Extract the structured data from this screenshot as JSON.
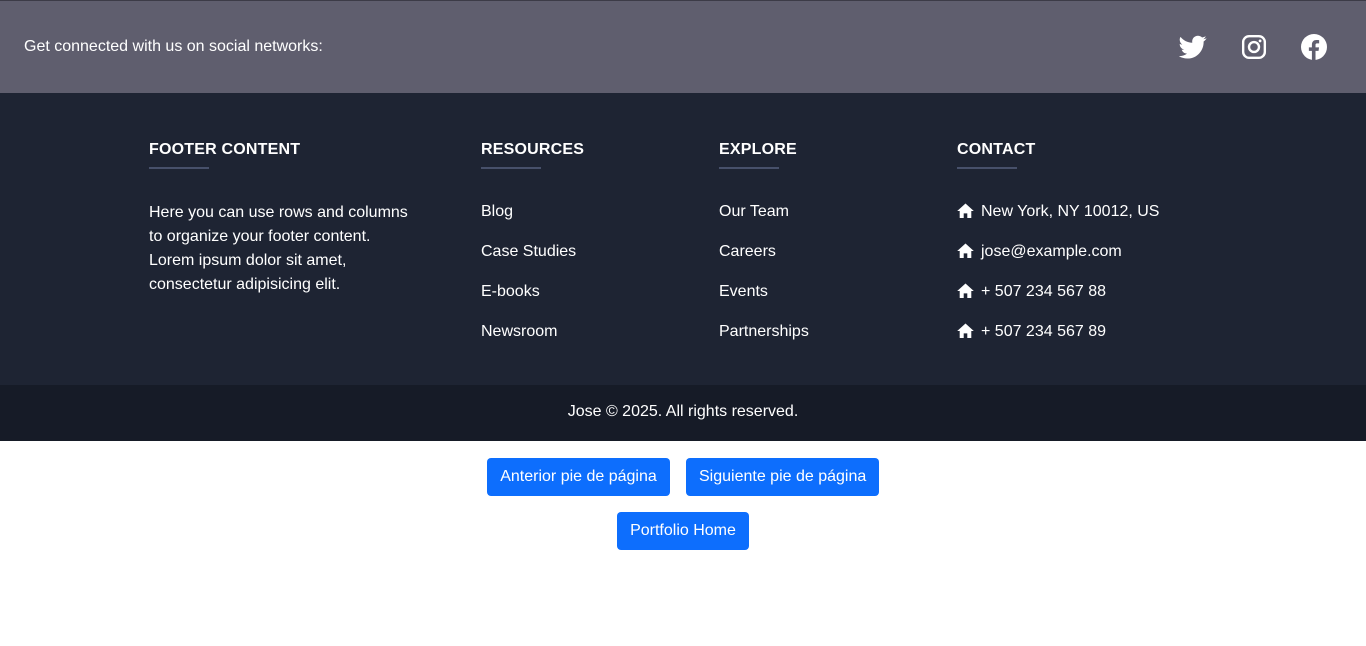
{
  "social": {
    "text": "Get connected with us on social networks:",
    "icons": [
      "twitter-icon",
      "instagram-icon",
      "facebook-icon"
    ]
  },
  "footer": {
    "about": {
      "title": "FOOTER CONTENT",
      "text": "Here you can use rows and columns to organize your footer content. Lorem ipsum dolor sit amet, consectetur adipisicing elit."
    },
    "resources": {
      "title": "RESOURCES",
      "links": [
        "Blog",
        "Case Studies",
        "E-books",
        "Newsroom"
      ]
    },
    "explore": {
      "title": "EXPLORE",
      "links": [
        "Our Team",
        "Careers",
        "Events",
        "Partnerships"
      ]
    },
    "contact": {
      "title": "CONTACT",
      "icon": "home-icon",
      "items": [
        "New York, NY 10012, US",
        "jose@example.com",
        "+ 507 234 567 88",
        "+ 507 234 567 89"
      ]
    }
  },
  "copyright": "Jose © 2025. All rights reserved.",
  "buttons": {
    "prev": "Anterior pie de página",
    "next": "Siguiente pie de página",
    "home": "Portfolio Home"
  },
  "colors": {
    "social_bar": "#5f5e6e",
    "footer_bg": "#1e2433",
    "copyright_bg": "#161b27",
    "accent": "#0d6efd"
  }
}
